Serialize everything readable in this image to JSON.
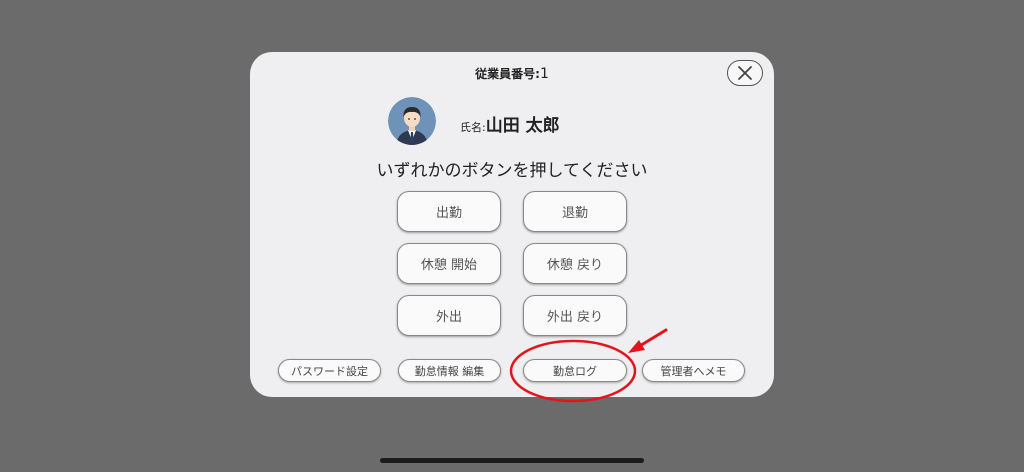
{
  "dialog": {
    "employee_number_label": "従業員番号:",
    "employee_number": "1",
    "name_label": "氏名:",
    "name": "山田 太郎",
    "instruction": "いずれかのボタンを押してください"
  },
  "buttons": {
    "clock_in": "出勤",
    "clock_out": "退勤",
    "break_start": "休憩 開始",
    "break_end": "休憩 戻り",
    "go_out": "外出",
    "return": "外出 戻り"
  },
  "footer": {
    "password": "パスワード設定",
    "edit_attendance": "勤怠情報 編集",
    "attendance_log": "勤怠ログ",
    "memo_to_admin": "管理者へメモ"
  },
  "colors": {
    "backdrop": "#6b6b6b",
    "dialog": "#efeff1",
    "annotation": "#e3141c"
  },
  "icons": {
    "close": "close-icon",
    "avatar": "avatar"
  }
}
